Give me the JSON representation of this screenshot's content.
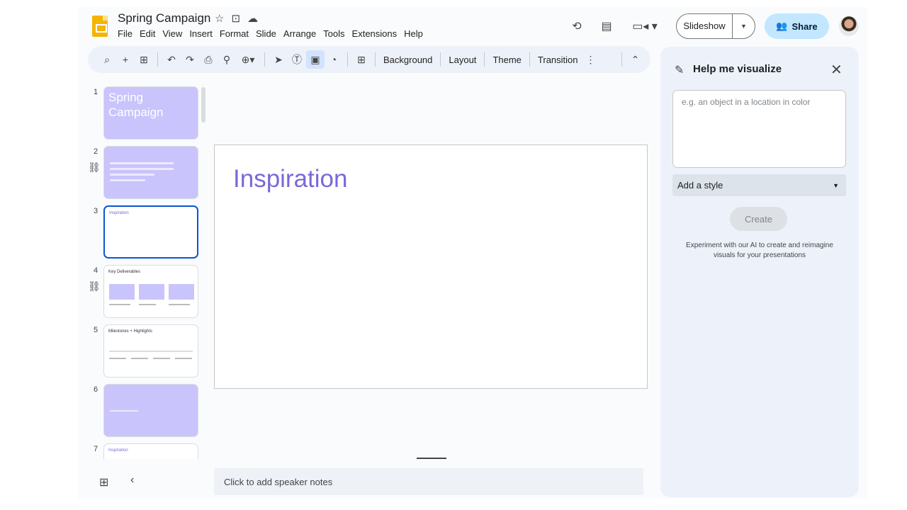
{
  "header": {
    "title": "Spring Campaign",
    "menu": [
      "File",
      "Edit",
      "View",
      "Insert",
      "Format",
      "Slide",
      "Arrange",
      "Tools",
      "Extensions",
      "Help"
    ],
    "slideshow_label": "Slideshow",
    "share_label": "Share"
  },
  "toolbar": {
    "background_label": "Background",
    "layout_label": "Layout",
    "theme_label": "Theme",
    "transition_label": "Transition"
  },
  "filmstrip": {
    "numbers": [
      "1",
      "2",
      "3",
      "4",
      "5",
      "6",
      "7"
    ],
    "slide1_title_line1": "Spring",
    "slide1_title_line2": "Campaign",
    "slide3_title": "Inspiration",
    "slide4_title": "Key Deliverables",
    "slide5_title": "Milestones + Highlights",
    "slide7_title": "Inspiration"
  },
  "canvas": {
    "title": "Inspiration",
    "speaker_notes_placeholder": "Click to add speaker notes"
  },
  "panel": {
    "title": "Help me visualize",
    "prompt_placeholder": "e.g. an object in a location in color",
    "style_label": "Add a style",
    "create_label": "Create",
    "note": "Experiment with our AI to create and reimagine visuals for your presentations"
  },
  "colors": {
    "accent_purple": "#7b68d9",
    "thumb_purple": "#c9c4fc",
    "share_bg": "#c2e7ff",
    "selection_blue": "#0b57d0"
  }
}
